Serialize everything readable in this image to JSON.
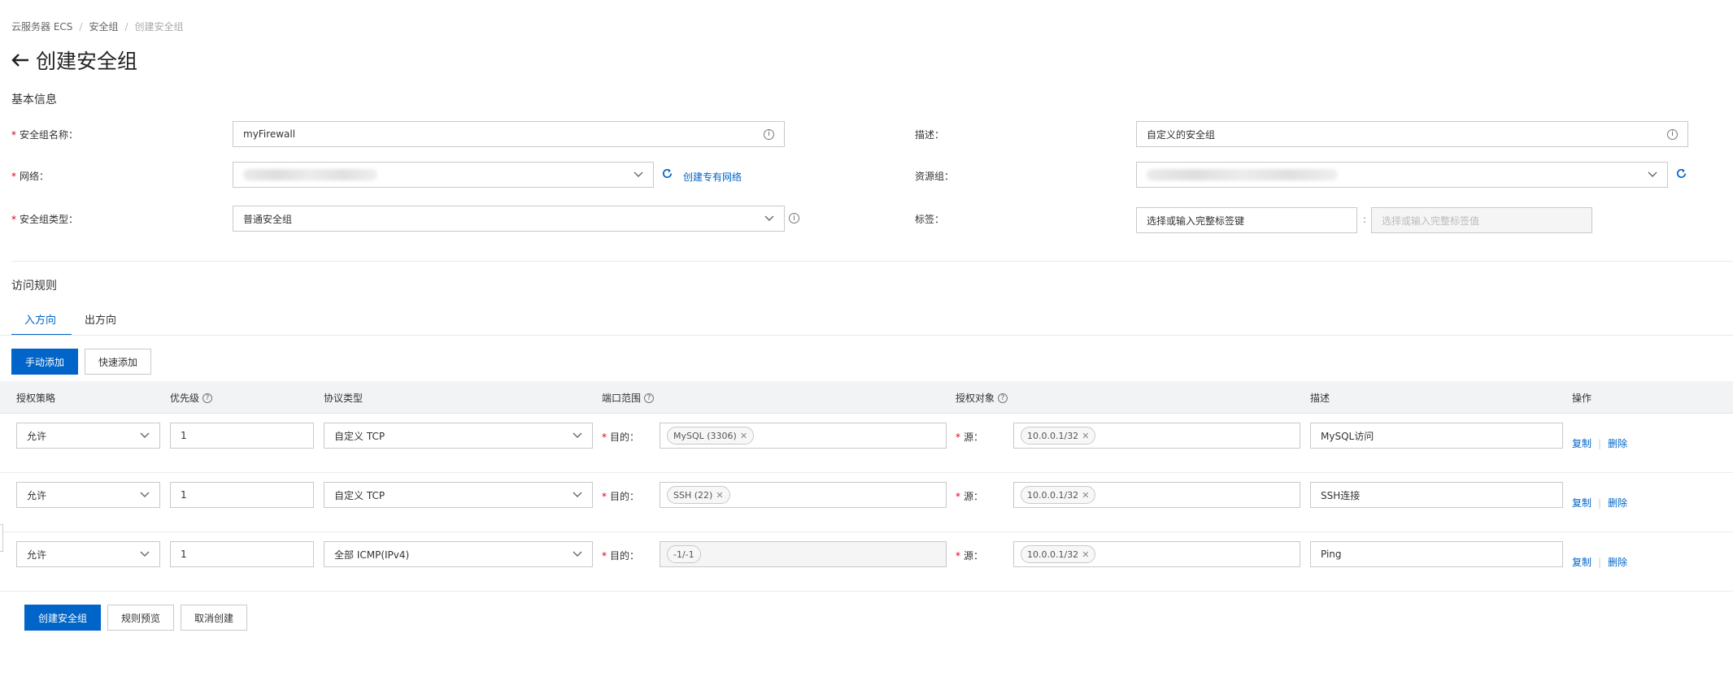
{
  "breadcrumb": [
    "云服务器 ECS",
    "安全组",
    "创建安全组"
  ],
  "page": {
    "title": "创建安全组"
  },
  "basic": {
    "section_title": "基本信息",
    "name_label": "安全组名称：",
    "name_value": "myFirewall",
    "desc_label": "描述：",
    "desc_value": "自定义的安全组",
    "network_label": "网络：",
    "create_vpc_link": "创建专有网络",
    "resource_group_label": "资源组：",
    "type_label": "安全组类型：",
    "type_value": "普通安全组",
    "tags_label": "标签：",
    "tag_key_placeholder": "选择或输入完整标签键",
    "tag_colon": ":",
    "tag_value_placeholder": "选择或输入完整标签值"
  },
  "rules": {
    "section_title": "访问规则",
    "tabs": [
      "入方向",
      "出方向"
    ],
    "manual_add": "手动添加",
    "quick_add": "快速添加",
    "columns": [
      "授权策略",
      "优先级",
      "协议类型",
      "端口范围",
      "授权对象",
      "描述",
      "操作"
    ],
    "dest_label": "目的：",
    "src_label": "源：",
    "rows": [
      {
        "policy": "允许",
        "priority": "1",
        "protocol": "自定义 TCP",
        "port": "MySQL (3306)",
        "source": "10.0.0.1/32",
        "desc": "MySQL访问"
      },
      {
        "policy": "允许",
        "priority": "1",
        "protocol": "自定义 TCP",
        "port": "SSH (22)",
        "source": "10.0.0.1/32",
        "desc": "SSH连接"
      },
      {
        "policy": "允许",
        "priority": "1",
        "protocol": "全部 ICMP(IPv4)",
        "port": "-1/-1",
        "source": "10.0.0.1/32",
        "desc": "Ping"
      }
    ],
    "copy_label": "复制",
    "delete_label": "删除"
  },
  "footer": {
    "create": "创建安全组",
    "preview": "规则预览",
    "cancel": "取消创建"
  },
  "colors": {
    "primary": "#0064c8",
    "required": "#d9001b"
  }
}
